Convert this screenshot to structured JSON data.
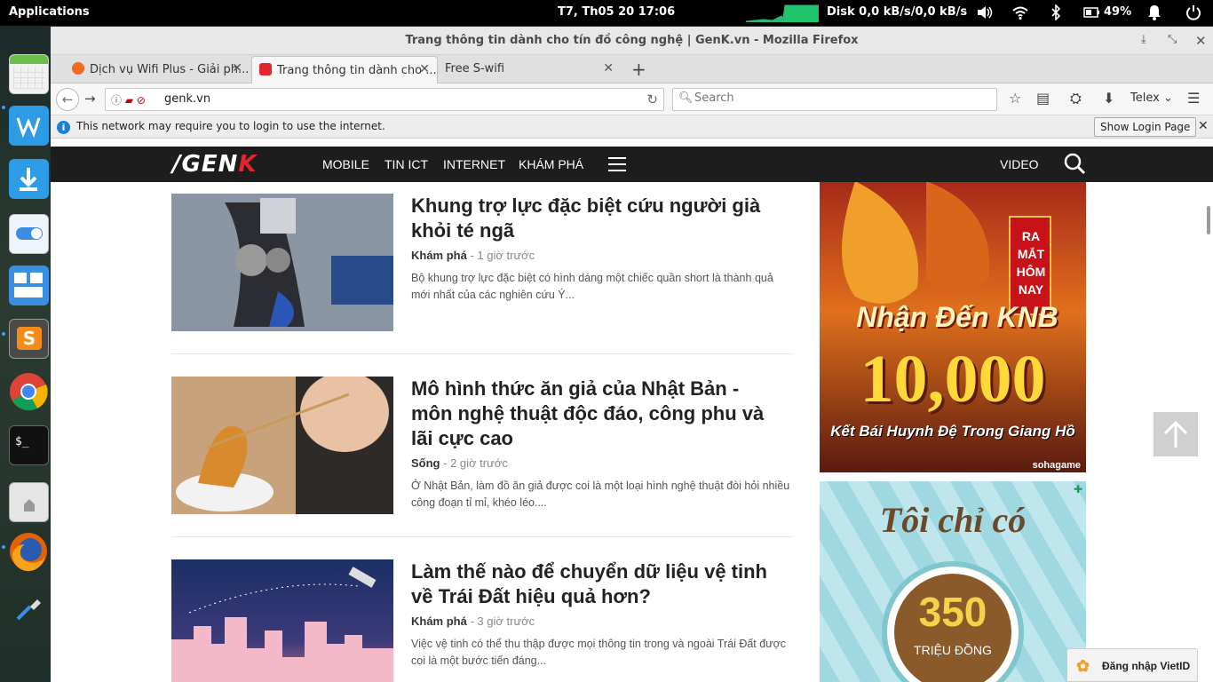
{
  "system_panel": {
    "apps_label": "Applications",
    "clock": "T7, Th05 20    17:06",
    "disk": "Disk 0,0 kB/s/0,0 kB/s",
    "battery": "49%"
  },
  "dock": {
    "items": [
      "calendar-icon",
      "writer-icon",
      "downloads-icon",
      "settings-toggle-icon",
      "workspace-icon",
      "sublime-text-icon",
      "chrome-icon",
      "terminal-icon",
      "files-icon",
      "firefox-icon",
      "color-picker-icon"
    ]
  },
  "window": {
    "title": "Trang thông tin dành cho tín đồ công nghệ | GenK.vn - Mozilla Firefox"
  },
  "tabs": [
    {
      "label": "Dịch vụ Wifi Plus - Giải ph...",
      "active": false
    },
    {
      "label": "Trang thông tin dành cho ...",
      "active": true
    },
    {
      "label": "Free S-wifi",
      "active": false
    }
  ],
  "navbar": {
    "url": "genk.vn",
    "search_placeholder": "Search",
    "input_method": "Telex"
  },
  "notification": {
    "message": "This network may require you to login to use the internet.",
    "button": "Show Login Page"
  },
  "site": {
    "logo": "/GENK",
    "nav": [
      "MOBILE",
      "TIN ICT",
      "INTERNET",
      "KHÁM PHÁ"
    ],
    "video": "VIDEO"
  },
  "articles": [
    {
      "title": "Khung trợ lực đặc biệt cứu người già khỏi té ngã",
      "category": "Khám phá",
      "time": "1 giờ trước",
      "desc": "Bộ khung trợ lực đặc biệt có hình dáng một chiếc quần short là thành quả mới nhất của các nghiên cứu Ý..."
    },
    {
      "title": "Mô hình thức ăn giả của Nhật Bản - môn nghệ thuật độc đáo, công phu và lãi cực cao",
      "category": "Sống",
      "time": "2 giờ trước",
      "desc": "Ở Nhật Bản, làm đồ ăn giả được coi là một loại hình nghệ thuật đòi hỏi nhiều công đoạn tỉ mỉ, khéo léo...."
    },
    {
      "title": "Làm thế nào để chuyển dữ liệu vệ tinh về Trái Đất hiệu quả hơn?",
      "category": "Khám phá",
      "time": "3 giờ trước",
      "desc": "Việc vệ tinh có thể thu thập được mọi thông tin trong và ngoài Trái Đất được coi là một bước tiến đáng..."
    }
  ],
  "ads": {
    "ad1": {
      "badge": "RA MẮT HÔM NAY",
      "line1": "Nhận Đến KNB",
      "amount": "10,000",
      "tagline": "Kết Bái Huynh Đệ Trong Giang Hồ",
      "brand": "sohagame"
    },
    "ad2": {
      "line1": "Tôi chỉ có",
      "amount": "350",
      "unit": "TRIỆU ĐỒNG"
    }
  },
  "vietid": "Đăng nhập VietID"
}
